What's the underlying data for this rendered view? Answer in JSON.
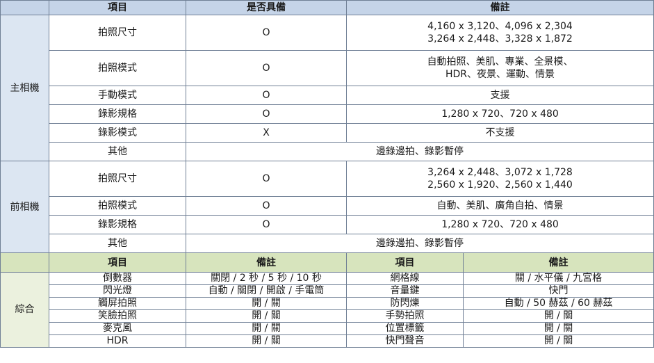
{
  "top_header": {
    "item": "項目",
    "supported": "是否具備",
    "notes": "備註"
  },
  "main_camera": {
    "label": "主相機",
    "rows": [
      {
        "item": "拍照尺寸",
        "supported": "O",
        "notes_lines": [
          "4,160 x 3,120、4,096 x 2,304",
          "3,264 x 2,448、3,328 x 1,872"
        ]
      },
      {
        "item": "拍照模式",
        "supported": "O",
        "notes_lines": [
          "自動拍照、美肌、專業、全景模、",
          "HDR、夜景、運動、情景"
        ]
      },
      {
        "item": "手動模式",
        "supported": "O",
        "notes_lines": [
          "支援"
        ]
      },
      {
        "item": "錄影規格",
        "supported": "O",
        "notes_lines": [
          "1,280 x 720、720 x 480"
        ]
      },
      {
        "item": "錄影模式",
        "supported": "X",
        "notes_lines": [
          "不支援"
        ]
      }
    ],
    "other": {
      "item": "其他",
      "value": "邊錄邊拍、錄影暫停"
    }
  },
  "front_camera": {
    "label": "前相機",
    "rows": [
      {
        "item": "拍照尺寸",
        "supported": "O",
        "notes_lines": [
          "3,264 x 2,448、3,072 x 1,728",
          "2,560 x 1,920、2,560 x 1,440"
        ]
      },
      {
        "item": "拍照模式",
        "supported": "O",
        "notes_lines": [
          "自動、美肌、廣角自拍、情景"
        ]
      },
      {
        "item": "錄影規格",
        "supported": "O",
        "notes_lines": [
          "1,280 x 720、720 x 480"
        ]
      }
    ],
    "other": {
      "item": "其他",
      "value": "邊錄邊拍、錄影暫停"
    }
  },
  "general_header": {
    "item1": "項目",
    "note1": "備註",
    "item2": "項目",
    "note2": "備註"
  },
  "general": {
    "label": "綜合",
    "rows": [
      {
        "item1": "倒數器",
        "note1": "關閉 / 2 秒 / 5 秒 / 10 秒",
        "item2": "網格線",
        "note2": "關 / 水平儀 / 九宮格"
      },
      {
        "item1": "閃光燈",
        "note1": "自動 / 關閉 / 開啟 / 手電筒",
        "item2": "音量鍵",
        "note2": "快門"
      },
      {
        "item1": "觸屏拍照",
        "note1": "開 / 關",
        "item2": "防閃爍",
        "note2": "自動 / 50 赫茲 / 60 赫茲"
      },
      {
        "item1": "笑臉拍照",
        "note1": "開 / 關",
        "item2": "手勢拍照",
        "note2": "開 / 關"
      },
      {
        "item1": "麥克風",
        "note1": "開 / 關",
        "item2": "位置標籤",
        "note2": "開 / 關"
      },
      {
        "item1": "HDR",
        "note1": "開 / 關",
        "item2": "快門聲音",
        "note2": "開 / 關"
      }
    ]
  }
}
